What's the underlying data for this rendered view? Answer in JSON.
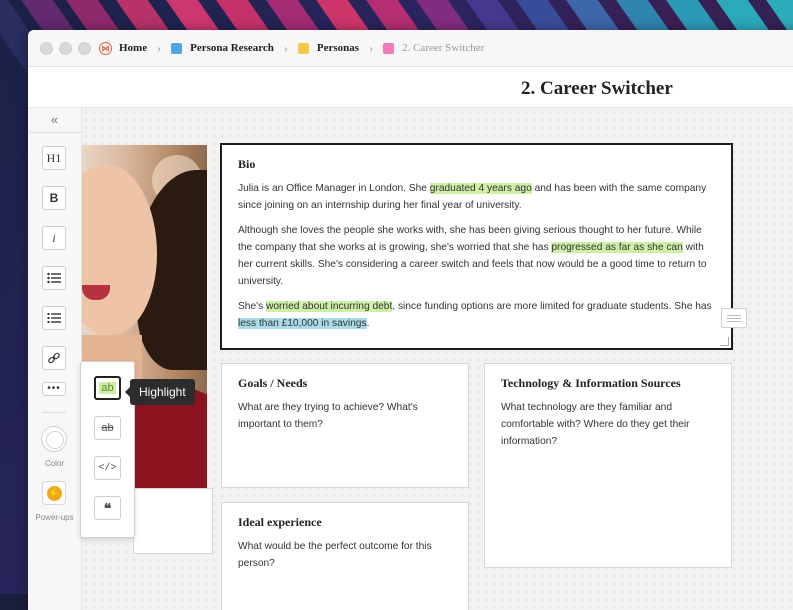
{
  "breadcrumb": {
    "items": [
      {
        "label": "Home",
        "color": "#e0603a"
      },
      {
        "label": "Persona Research",
        "color": "#4da6e0"
      },
      {
        "label": "Personas",
        "color": "#f7c948"
      },
      {
        "label": "2. Career Switcher",
        "color": "#f27ab8"
      }
    ]
  },
  "page": {
    "title": "2. Career Switcher"
  },
  "toolbar": {
    "collapse_icon": "double-chevron-left-icon",
    "h1": "H1",
    "bold": "B",
    "italic": "i",
    "color_label": "Color",
    "powerups_label": "Power-ups"
  },
  "format_popout": {
    "highlight": "ab",
    "strikethrough": "ab",
    "code": "</>",
    "quote": "❝"
  },
  "tooltip": "Highlight",
  "cards": {
    "bio": {
      "title": "Bio",
      "p1_a": "Julia is an Office Manager in London. She ",
      "p1_hl": "graduated 4 years ago",
      "p1_b": " and has been with the same company since joining on an internship during her final year of university.",
      "p2_a": "Although she loves the people she works with, she has been giving serious thought to her future. While the company that she works at is growing,  she's worried that she has ",
      "p2_hl": "progressed as far as she can",
      "p2_b": " with her current skills. She's considering a career switch and feels that now would be a good time to return to university.",
      "p3_a": "She's ",
      "p3_hl": "worried about incurring debt",
      "p3_b": ", since funding options are more limited for graduate students. She has ",
      "p3_hl2": "less than £10,000 in savings",
      "p3_c": "."
    },
    "goals": {
      "title": "Goals / Needs",
      "body": "What are they trying to achieve? What's important to them?"
    },
    "tech": {
      "title": "Technology & Information Sources",
      "body": "What technology are they familiar and comfortable with? Where do they get their information?"
    },
    "ideal": {
      "title": "Ideal experience",
      "body": "What would be the perfect outcome for this person?"
    }
  },
  "colors": {
    "highlight_green": "#cef0a6",
    "highlight_blue": "#a9dbe8",
    "brand": "#e0603a"
  }
}
